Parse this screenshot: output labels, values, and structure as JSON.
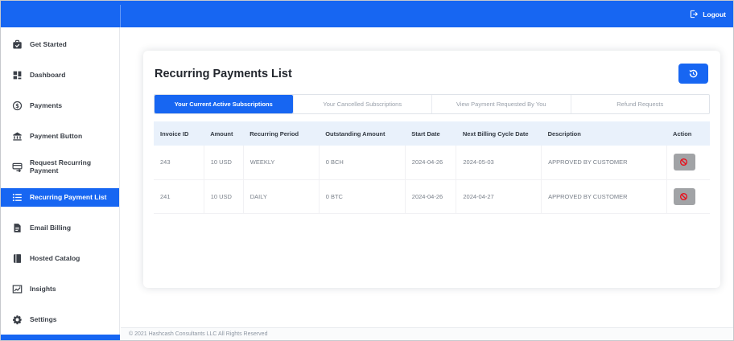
{
  "colors": {
    "primary_blue": "#1766f2",
    "action_button_gray": "#a1a3a6",
    "ban_red": "#e8101c",
    "table_header_bg": "#e9f1fb"
  },
  "topbar": {
    "logout_label": "Logout",
    "logout_icon": "logout-icon"
  },
  "sidebar": {
    "items": [
      {
        "label": "Get Started",
        "icon": "clipboard-check-icon",
        "active": false
      },
      {
        "label": "Dashboard",
        "icon": "grid-icon",
        "active": false
      },
      {
        "label": "Payments",
        "icon": "dollar-circle-icon",
        "active": false
      },
      {
        "label": "Payment Button",
        "icon": "bank-icon",
        "active": false
      },
      {
        "label": "Request Recurring Payment",
        "icon": "card-arrow-icon",
        "active": false
      },
      {
        "label": "Recurring Payment List",
        "icon": "list-icon",
        "active": true
      },
      {
        "label": "Email Billing",
        "icon": "document-icon",
        "active": false
      },
      {
        "label": "Hosted Catalog",
        "icon": "book-icon",
        "active": false
      },
      {
        "label": "Insights",
        "icon": "chart-icon",
        "active": false
      },
      {
        "label": "Settings",
        "icon": "gear-icon",
        "active": false
      }
    ]
  },
  "main": {
    "title": "Recurring Payments List",
    "history_button_icon": "history-icon",
    "tabs": [
      {
        "label": "Your Current Active Subscriptions",
        "active": true
      },
      {
        "label": "Your Cancelled Subscriptions",
        "active": false
      },
      {
        "label": "View Payment Requested By You",
        "active": false
      },
      {
        "label": "Refund Requests",
        "active": false
      }
    ],
    "table": {
      "columns": [
        "Invoice ID",
        "Amount",
        "Recurring Period",
        "Outstanding Amount",
        "Start Date",
        "Next Billing Cycle Date",
        "Description",
        "Action"
      ],
      "rows": [
        {
          "invoice_id": "243",
          "amount": "10 USD",
          "recurring_period": "WEEKLY",
          "outstanding_amount": "0 BCH",
          "start_date": "2024-04-26",
          "next_billing_cycle_date": "2024-05-03",
          "description": "APPROVED BY CUSTOMER",
          "action_icon": "ban-icon"
        },
        {
          "invoice_id": "241",
          "amount": "10 USD",
          "recurring_period": "DAILY",
          "outstanding_amount": "0 BTC",
          "start_date": "2024-04-26",
          "next_billing_cycle_date": "2024-04-27",
          "description": "APPROVED BY CUSTOMER",
          "action_icon": "ban-icon"
        }
      ]
    }
  },
  "footer": {
    "copyright": "© 2021 Hashcash Consultants LLC All Rights Reserved"
  }
}
